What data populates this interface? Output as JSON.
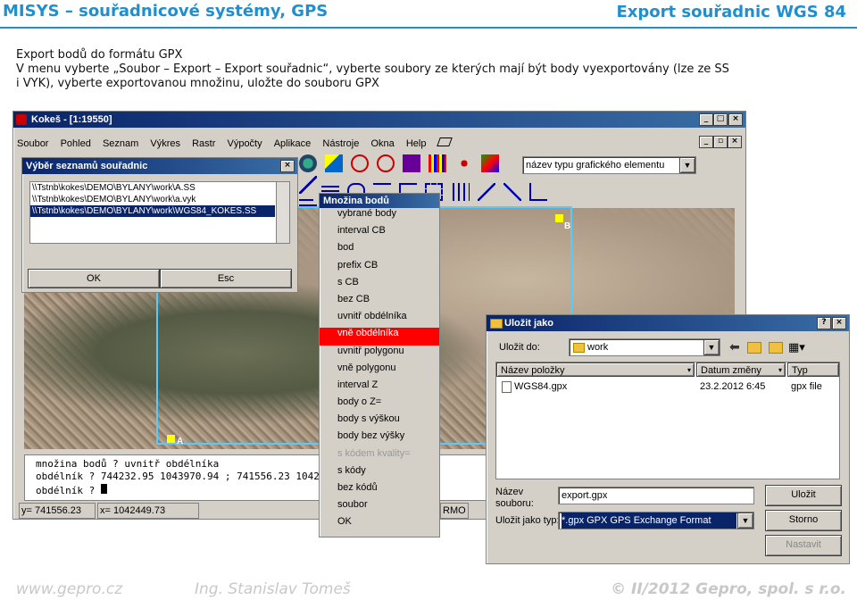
{
  "slide": {
    "header_left": "MISYS – souřadnicové systémy, GPS",
    "header_right": "Export souřadnic WGS 84",
    "desc_line1": "Export bodů do formátu GPX",
    "desc_line2": "V menu vyberte „Soubor – Export – Export souřadnic“, vyberte soubory ze kterých mají být body vyexportovány (lze ze SS",
    "desc_line3": "i VYK), vyberte exportovanou množinu, uložte do souboru GPX",
    "footer_left": "www.gepro.cz",
    "footer_mid": "Ing. Stanislav Tomeš",
    "footer_right": "© II/2012 Gepro, spol. s r.o."
  },
  "main_window": {
    "title": "Kokeš - [1:19550]",
    "menu": [
      "Soubor",
      "Pohled",
      "Seznam",
      "Výkres",
      "Rastr",
      "Výpočty",
      "Aplikace",
      "Nástroje",
      "Okna",
      "Help"
    ],
    "combo_value": "název typu grafického elementu",
    "cmd_lines": [
      "množina bodů ? uvnitř obdélníka",
      "obdélník ? 744232.95 1043970.94 ; 741556.23 1042",
      "obdélník ? "
    ],
    "status_y": "y=  741556.23",
    "status_x": "x=  1042449.73",
    "status_mode": "RMO",
    "map_label_a": "A",
    "map_label_b": "B"
  },
  "list_dialog": {
    "title": "Výběr seznamů souřadnic",
    "items": [
      "\\\\Tstnb\\kokes\\DEMO\\BYLANY\\work\\A.SS",
      "\\\\Tstnb\\kokes\\DEMO\\BYLANY\\work\\a.vyk",
      "\\\\Tstnb\\kokes\\DEMO\\BYLANY\\work\\WGS84_KOKES.SS"
    ],
    "ok_label": "OK",
    "esc_label": "Esc"
  },
  "set_menu": {
    "title": "Množina bodů",
    "items": [
      "vybrané body",
      "interval CB",
      "bod",
      "prefix CB",
      "s CB",
      "bez CB",
      "uvnitř obdélníka",
      "vně obdélníka",
      "uvnitř polygonu",
      "vně polygonu",
      "interval Z",
      "body o Z=",
      "body s výškou",
      "body bez výšky",
      "s kódem kvality=",
      "s kódy",
      "bez kódů",
      "soubor",
      "OK"
    ],
    "highlight_index": 7,
    "disabled_index": 14
  },
  "save_dialog": {
    "title": "Uložit jako",
    "save_in_label": "Uložit do:",
    "save_in_value": "work",
    "col_name": "Název položky",
    "col_date": "Datum změny",
    "col_type": "Typ",
    "file_name": "WGS84.gpx",
    "file_date": "23.2.2012 6:45",
    "file_type": "gpx file",
    "name_label_1": "Název",
    "name_label_2": "souboru:",
    "name_value": "export.gpx",
    "type_label": "Uložit jako typ:",
    "type_value": "*.gpx  GPX GPS Exchange Format",
    "save_button": "Uložit",
    "cancel_button": "Storno",
    "setup_button": "Nastavit"
  },
  "colors": {
    "accent": "#1f8fd0",
    "title_bar": "#0a246a",
    "highlight": "#ff0000",
    "selection": "#0a246a"
  }
}
